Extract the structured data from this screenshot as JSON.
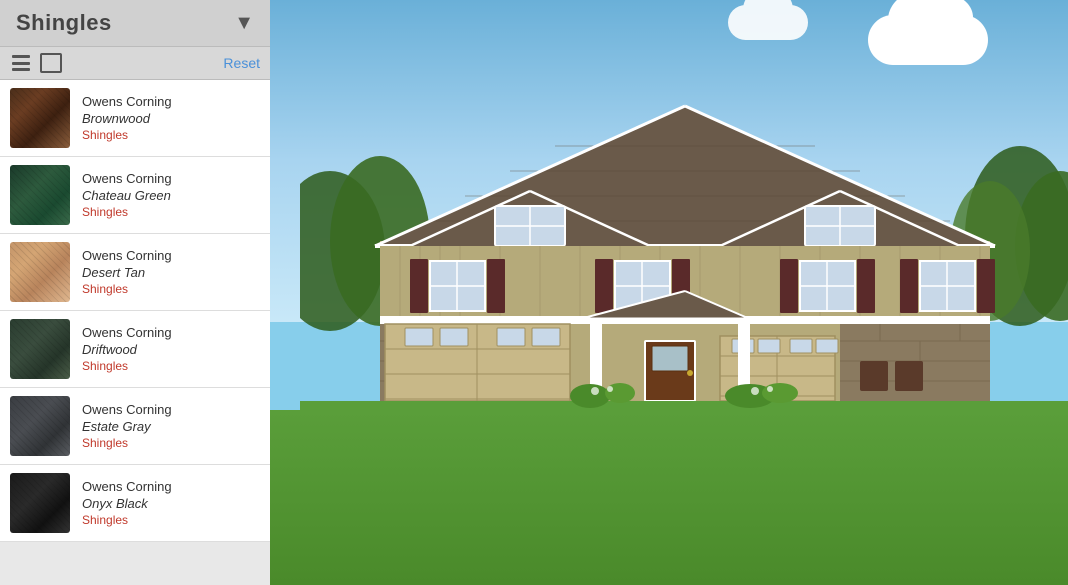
{
  "panel": {
    "title": "Shingles",
    "chevron": "▼",
    "reset_label": "Reset",
    "view_list_label": "list view",
    "view_grid_label": "grid view"
  },
  "items": [
    {
      "id": "brownwood",
      "brand": "Owens Corning",
      "name": "Brownwood",
      "category": "Shingles",
      "swatch_class": "swatch-brownwood"
    },
    {
      "id": "chateau-green",
      "brand": "Owens Corning",
      "name": "Chateau Green",
      "category": "Shingles",
      "swatch_class": "swatch-chateau-green"
    },
    {
      "id": "desert-tan",
      "brand": "Owens Corning",
      "name": "Desert Tan",
      "category": "Shingles",
      "swatch_class": "swatch-desert-tan"
    },
    {
      "id": "driftwood",
      "brand": "Owens Corning",
      "name": "Driftwood",
      "category": "Shingles",
      "swatch_class": "swatch-driftwood"
    },
    {
      "id": "estate-gray",
      "brand": "Owens Corning",
      "name": "Estate Gray",
      "category": "Shingles",
      "swatch_class": "swatch-estate-gray"
    },
    {
      "id": "onyx-black",
      "brand": "Owens Corning",
      "name": "Onyx Black",
      "category": "Shingles",
      "swatch_class": "swatch-onyx-black"
    }
  ],
  "house": {
    "scene_description": "Two-story craftsman house with tan siding, stone accents, brown shutters, two-car garage"
  }
}
